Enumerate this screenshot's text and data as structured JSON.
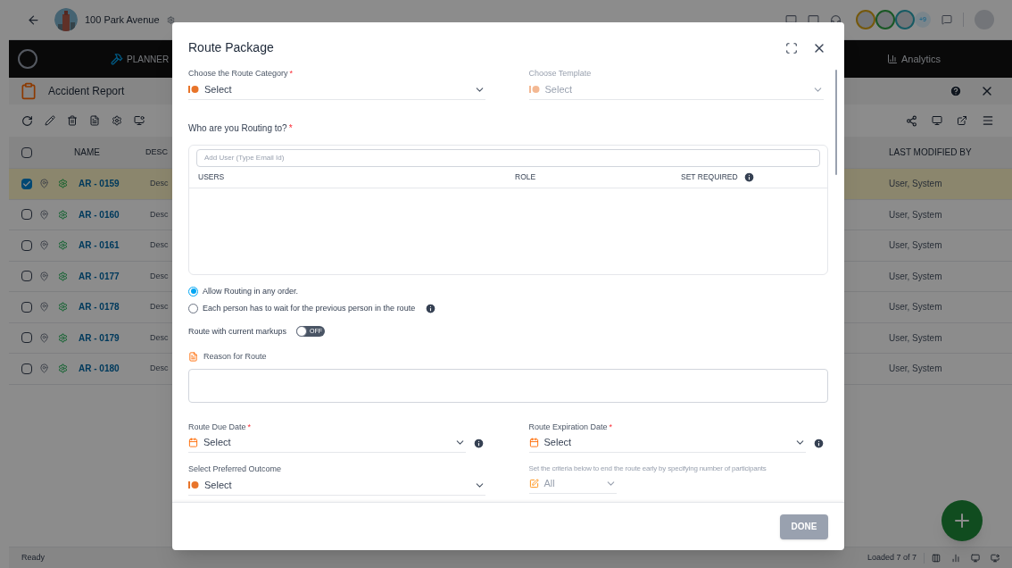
{
  "header": {
    "project": "100 Park Avenue",
    "extra_collaborators": "+9"
  },
  "nav": [
    {
      "kind": "planner",
      "label": "PLANNER"
    },
    {
      "kind": "analytics",
      "label": "Analytics"
    }
  ],
  "panel": {
    "title": "Accident Report"
  },
  "table": {
    "all_checked": false,
    "columns": [
      "NAME",
      "DESC",
      "LAST MODIFIED BY"
    ],
    "rows": [
      {
        "checked": true,
        "name": "AR - 0159",
        "description": "Desc",
        "modified_by": "User, System"
      },
      {
        "checked": false,
        "name": "AR - 0160",
        "description": "Desc",
        "modified_by": "User, System"
      },
      {
        "checked": false,
        "name": "AR - 0161",
        "description": "Desc",
        "modified_by": "User, System"
      },
      {
        "checked": false,
        "name": "AR - 0177",
        "description": "Desc",
        "modified_by": "User, System"
      },
      {
        "checked": false,
        "name": "AR - 0178",
        "description": "Desc",
        "modified_by": "User, System"
      },
      {
        "checked": false,
        "name": "AR - 0179",
        "description": "Desc",
        "modified_by": "User, System"
      },
      {
        "checked": false,
        "name": "AR - 0180",
        "description": "Desc",
        "modified_by": "User, System"
      }
    ]
  },
  "status_bar": {
    "left": "Ready",
    "right": "Loaded 7 of 7"
  },
  "dialog": {
    "title": "Route Package",
    "category": {
      "label": "Choose the Route Category",
      "required_mark": "*",
      "placeholder": "Select"
    },
    "template": {
      "label": "Choose Template",
      "placeholder": "Select",
      "disabled": true
    },
    "recipients": {
      "label": "Who are you Routing to?",
      "required_mark": "*",
      "placeholder": "Add User (Type Email Id)",
      "columns": [
        "USERS",
        "ROLE",
        "SET REQUIRED"
      ]
    },
    "order_options": [
      {
        "label": "Allow Routing in any order.",
        "selected": true,
        "info": false
      },
      {
        "label": "Each person has to wait for the previous person in the route",
        "selected": false,
        "info": true
      }
    ],
    "markups": {
      "label": "Route with current markups",
      "on": false,
      "state_text": "OFF"
    },
    "reason": {
      "label": "Reason for Route"
    },
    "due_date": {
      "label": "Route Due Date",
      "required_mark": "*",
      "placeholder": "Select",
      "info": true
    },
    "expiration_date": {
      "label": "Route Expiration Date",
      "required_mark": "*",
      "placeholder": "Select",
      "info": true
    },
    "outcome": {
      "label": "Select Preferred Outcome",
      "placeholder": "Select"
    },
    "criteria": {
      "label": "Set the criteria below to end the route early by specifying number of participants",
      "value": "All",
      "disabled": true
    },
    "done_button": {
      "label": "DONE",
      "disabled": true
    }
  }
}
